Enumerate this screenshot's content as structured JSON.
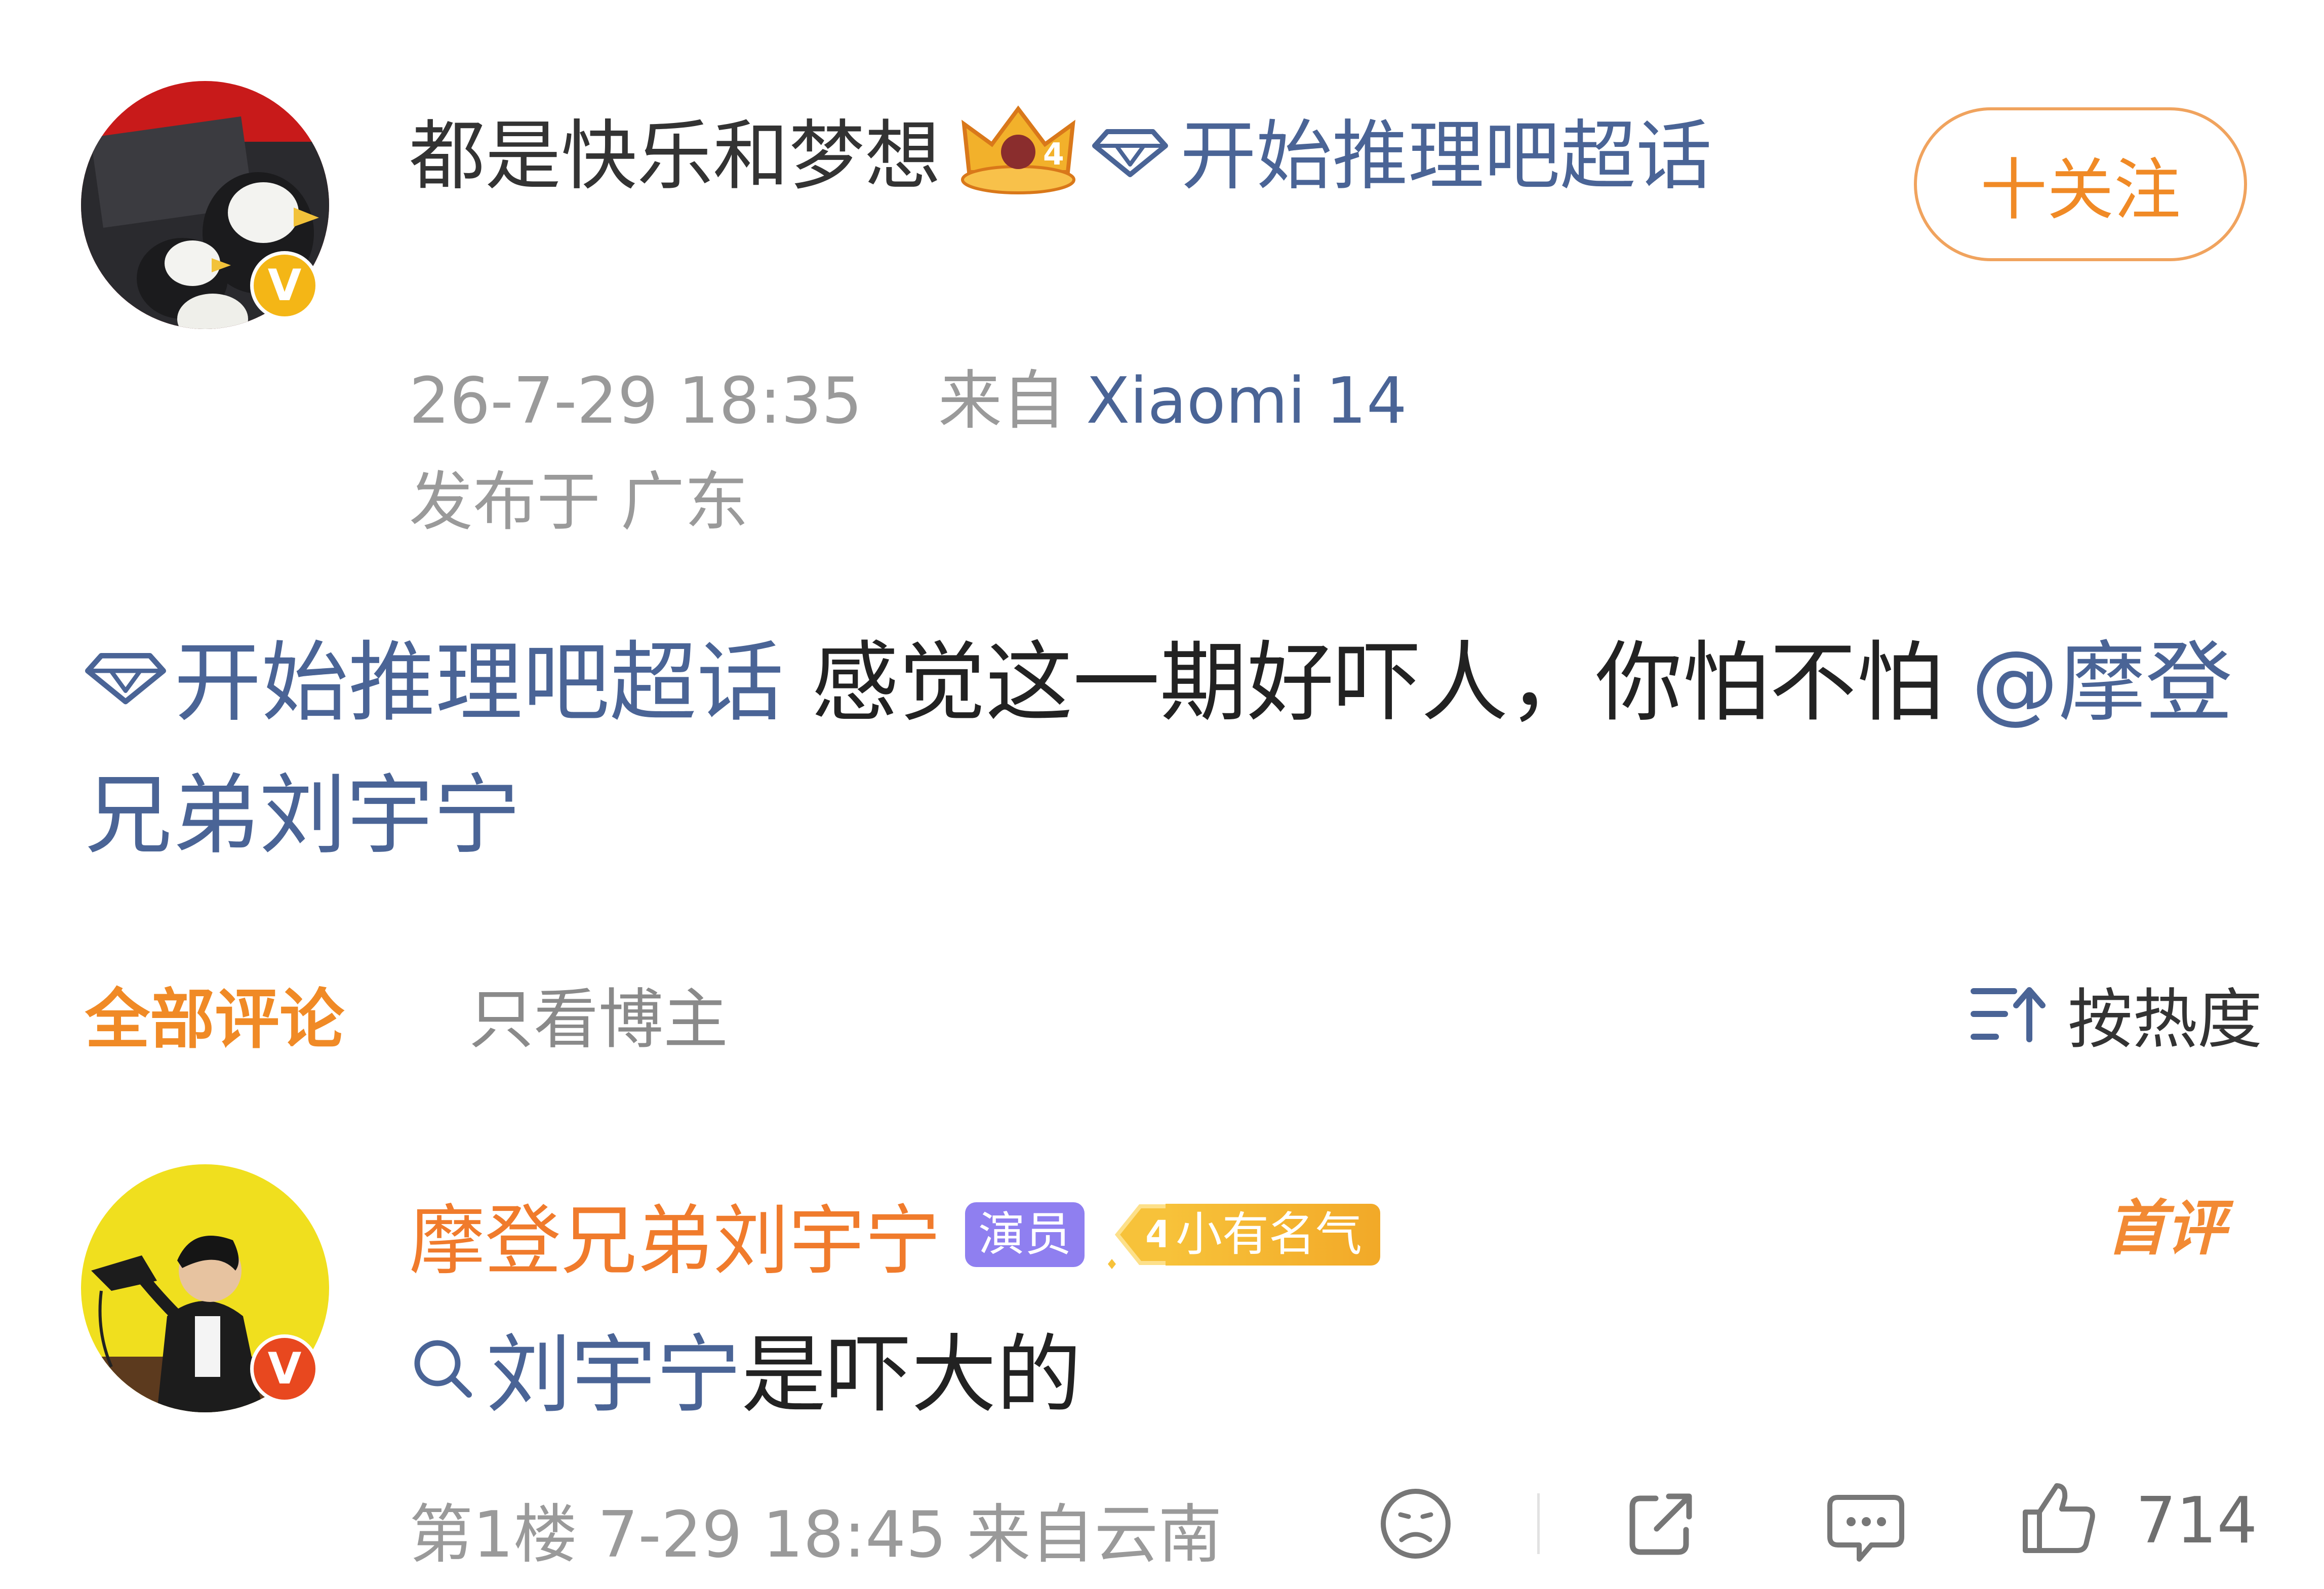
{
  "post": {
    "author_name": "都是快乐和梦想",
    "crown_level": "4",
    "author_topic": "开始推理吧超话",
    "follow_label": "十关注",
    "time": "26-7-29 18:35",
    "source_prefix": "来自",
    "source_device": "Xiaomi 14",
    "location": "发布于 广东",
    "body_topic": "开始推理吧超话",
    "body_text": " 感觉这一期好吓人，你怕不怕",
    "body_mention": "@摩登兄弟刘宇宁",
    "avatar_badge": "V"
  },
  "comments_bar": {
    "tab_all": "全部评论",
    "tab_author_only": "只看博主",
    "sort_label": "按热度"
  },
  "comment": {
    "name": "摩登兄弟刘宇宁",
    "role_tag": "演员",
    "level_number": "4",
    "level_label": "小有名气",
    "first_tag": "首评",
    "search_link": "刘宇宁",
    "text": "是吓大的",
    "floor": "第1楼",
    "time": "7-29 18:45",
    "source": "来自云南",
    "like_count": "714",
    "avatar_badge": "V"
  },
  "icons": [
    "crown-icon",
    "diamond-topic-icon",
    "sort-icon",
    "search-icon",
    "sad-face-icon",
    "share-icon",
    "comment-icon",
    "like-icon"
  ],
  "colors": {
    "accent_orange": "#f08a26",
    "link_blue": "#4a6496",
    "meta_gray": "#9a9a9a",
    "badge_gold": "#f4b616",
    "badge_red": "#e8481f",
    "actor_purple": "#8f7ff0"
  }
}
